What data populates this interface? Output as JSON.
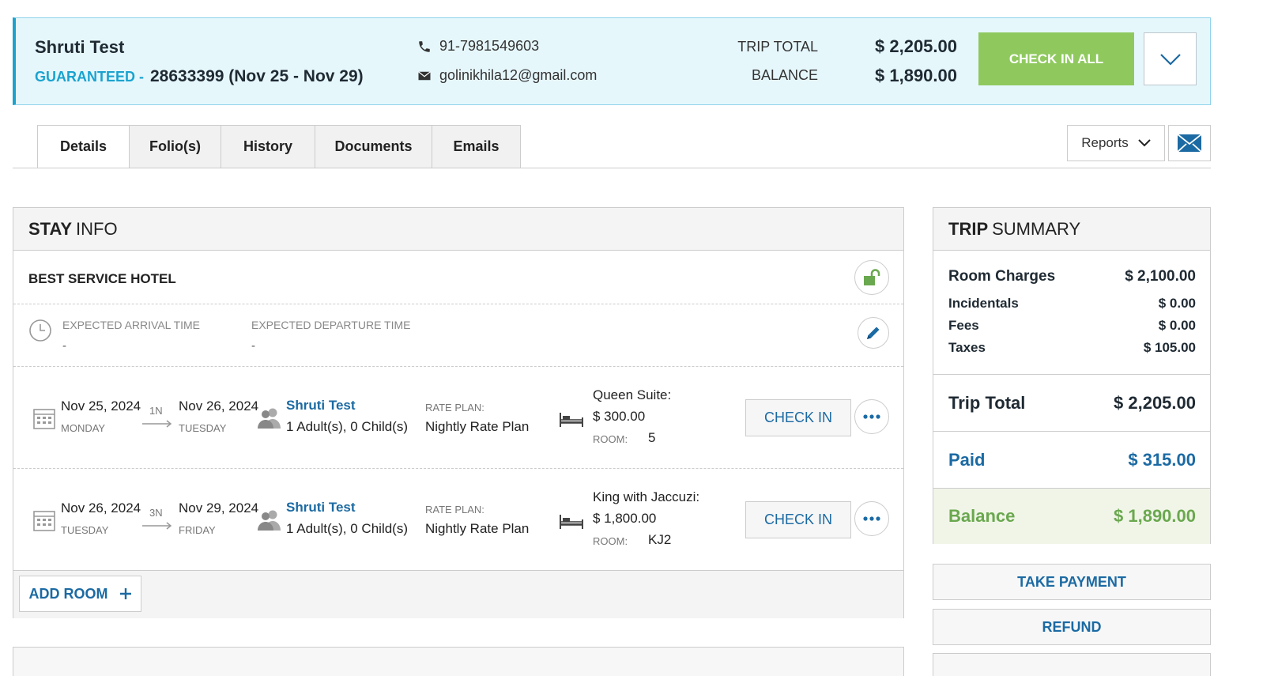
{
  "header": {
    "guest_name": "Shruti Test",
    "status": "GUARANTEED -",
    "confirmation": "28633399 (Nov 25 - Nov 29)",
    "phone": "91-7981549603",
    "email": "golinikhila12@gmail.com",
    "trip_total_label": "TRIP TOTAL",
    "trip_total_value": "$ 2,205.00",
    "balance_label": "BALANCE",
    "balance_value": "$ 1,890.00",
    "check_in_all": "CHECK IN ALL",
    "colors": {
      "accent": "#1aa3cf",
      "check_in_all_bg": "#8fc95e",
      "banner_bg": "#e6f7fc"
    }
  },
  "tabs": [
    {
      "label": "Details",
      "active": true
    },
    {
      "label": "Folio(s)"
    },
    {
      "label": "History"
    },
    {
      "label": "Documents"
    },
    {
      "label": "Emails"
    }
  ],
  "toolbar": {
    "reports_label": "Reports",
    "email_icon": "envelope-icon"
  },
  "stay_info": {
    "title_bold": "STAY",
    "title_rest": "INFO",
    "hotel_name": "BEST SERVICE HOTEL",
    "expected_arrival_label": "EXPECTED ARRIVAL TIME",
    "expected_arrival_value": "-",
    "expected_departure_label": "EXPECTED DEPARTURE TIME",
    "expected_departure_value": "-",
    "rooms": [
      {
        "arrival_date": "Nov 25, 2024",
        "arrival_day": "MONDAY",
        "nights": "1N",
        "departure_date": "Nov 26, 2024",
        "departure_day": "TUESDAY",
        "guest": "Shruti Test",
        "occupancy": "1 Adult(s), 0 Child(s)",
        "rate_plan_label": "RATE PLAN:",
        "rate_plan": "Nightly Rate Plan",
        "room_type": "Queen Suite:",
        "rate": "$ 300.00",
        "room_label": "ROOM:",
        "room": "5",
        "check_in": "CHECK IN"
      },
      {
        "arrival_date": "Nov 26, 2024",
        "arrival_day": "TUESDAY",
        "nights": "3N",
        "departure_date": "Nov 29, 2024",
        "departure_day": "FRIDAY",
        "guest": "Shruti Test",
        "occupancy": "1 Adult(s), 0 Child(s)",
        "rate_plan_label": "RATE PLAN:",
        "rate_plan": "Nightly Rate Plan",
        "room_type": "King with Jaccuzi:",
        "rate": "$ 1,800.00",
        "room_label": "ROOM:",
        "room": "KJ2",
        "check_in": "CHECK IN"
      }
    ],
    "add_room": "ADD ROOM"
  },
  "trip_summary": {
    "title_bold": "TRIP",
    "title_rest": "SUMMARY",
    "room_charges_label": "Room Charges",
    "room_charges": "$ 2,100.00",
    "incidentals_label": "Incidentals",
    "incidentals": "$ 0.00",
    "fees_label": "Fees",
    "fees": "$ 0.00",
    "taxes_label": "Taxes",
    "taxes": "$ 105.00",
    "trip_total_label": "Trip Total",
    "trip_total": "$ 2,205.00",
    "paid_label": "Paid",
    "paid": "$ 315.00",
    "balance_label": "Balance",
    "balance": "$ 1,890.00",
    "take_payment": "TAKE PAYMENT",
    "refund": "REFUND"
  }
}
